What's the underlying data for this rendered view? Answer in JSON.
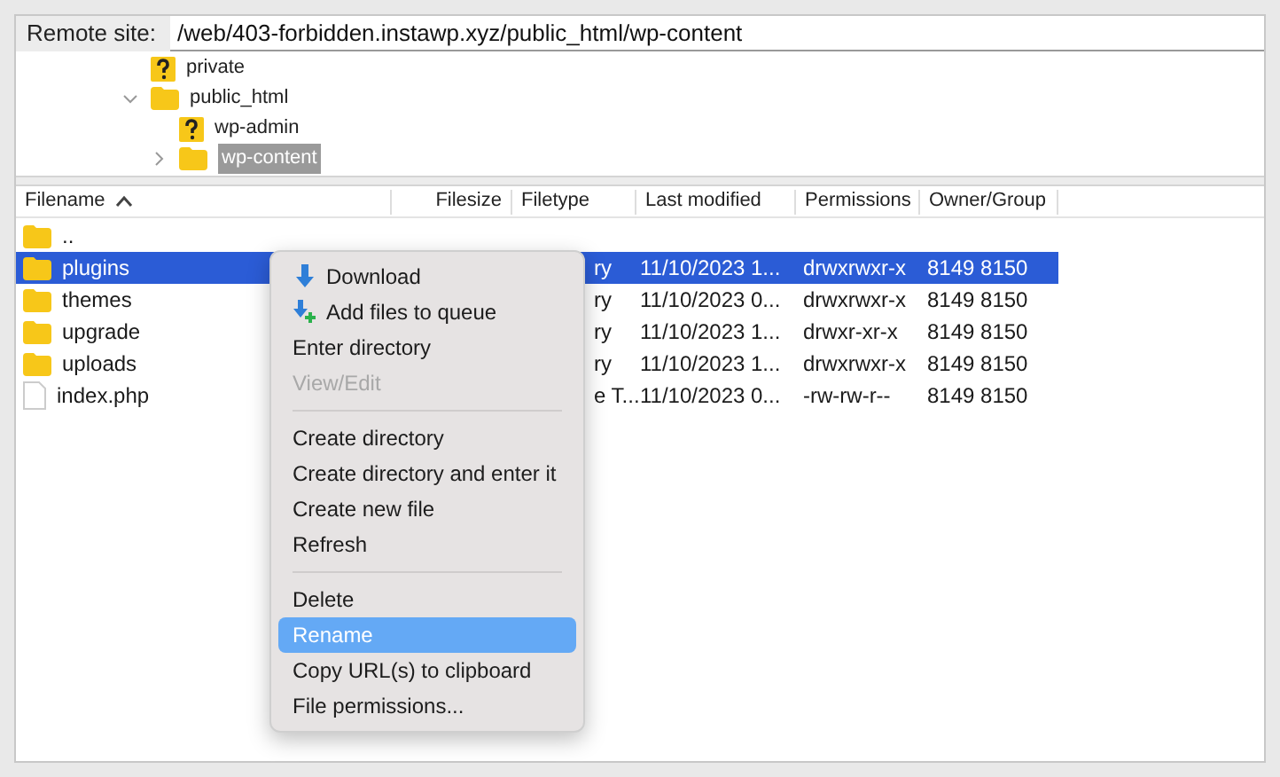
{
  "remote_site": {
    "label": "Remote site:",
    "value": "/web/403-forbidden.instawp.xyz/public_html/wp-content"
  },
  "tree": [
    {
      "name": "private",
      "kind": "unknown"
    },
    {
      "name": "public_html",
      "kind": "folder",
      "expanded": true,
      "selected": false,
      "children": [
        {
          "name": "wp-admin",
          "kind": "unknown"
        },
        {
          "name": "wp-content",
          "kind": "folder",
          "expanded": false,
          "selected": true
        }
      ]
    }
  ],
  "table": {
    "columns": [
      {
        "label": "Filename",
        "sorted": true
      },
      {
        "label": "Filesize",
        "sorted": false
      },
      {
        "label": "Filetype",
        "sorted": false
      },
      {
        "label": "Last modified",
        "sorted": false
      },
      {
        "label": "Permissions",
        "sorted": false
      },
      {
        "label": "Owner/Group",
        "sorted": false
      }
    ],
    "rows": [
      {
        "kind": "folder",
        "name": "..",
        "selected": false
      },
      {
        "kind": "folder",
        "name": "plugins",
        "filetype": "ry",
        "modified": "11/10/2023 1...",
        "permissions": "drwxrwxr-x",
        "owner": "8149 8150",
        "selected": true
      },
      {
        "kind": "folder",
        "name": "themes",
        "filetype": "ry",
        "modified": "11/10/2023 0...",
        "permissions": "drwxrwxr-x",
        "owner": "8149 8150",
        "selected": false
      },
      {
        "kind": "folder",
        "name": "upgrade",
        "filetype": "ry",
        "modified": "11/10/2023 1...",
        "permissions": "drwxr-xr-x",
        "owner": "8149 8150",
        "selected": false
      },
      {
        "kind": "folder",
        "name": "uploads",
        "filetype": "ry",
        "modified": "11/10/2023 1...",
        "permissions": "drwxrwxr-x",
        "owner": "8149 8150",
        "selected": false
      },
      {
        "kind": "file",
        "name": "index.php",
        "filetype": "e T...",
        "modified": "11/10/2023 0...",
        "permissions": "-rw-rw-r--",
        "owner": "8149 8150",
        "selected": false
      }
    ]
  },
  "context_menu": {
    "groups": [
      [
        {
          "label": "Download",
          "kind": "download",
          "disabled": false,
          "selected": false
        },
        {
          "label": "Add files to queue",
          "kind": "queue",
          "disabled": false,
          "selected": false
        },
        {
          "label": "Enter directory",
          "kind": "plain",
          "disabled": false,
          "selected": false
        },
        {
          "label": "View/Edit",
          "kind": "plain",
          "disabled": true,
          "selected": false
        }
      ],
      [
        {
          "label": "Create directory",
          "kind": "plain",
          "disabled": false,
          "selected": false
        },
        {
          "label": "Create directory and enter it",
          "kind": "plain",
          "disabled": false,
          "selected": false
        },
        {
          "label": "Create new file",
          "kind": "plain",
          "disabled": false,
          "selected": false
        },
        {
          "label": "Refresh",
          "kind": "plain",
          "disabled": false,
          "selected": false
        }
      ],
      [
        {
          "label": "Delete",
          "kind": "plain",
          "disabled": false,
          "selected": false
        },
        {
          "label": "Rename",
          "kind": "plain",
          "disabled": false,
          "selected": true
        },
        {
          "label": "Copy URL(s) to clipboard",
          "kind": "plain",
          "disabled": false,
          "selected": false
        },
        {
          "label": "File permissions...",
          "kind": "plain",
          "disabled": false,
          "selected": false
        }
      ]
    ]
  }
}
